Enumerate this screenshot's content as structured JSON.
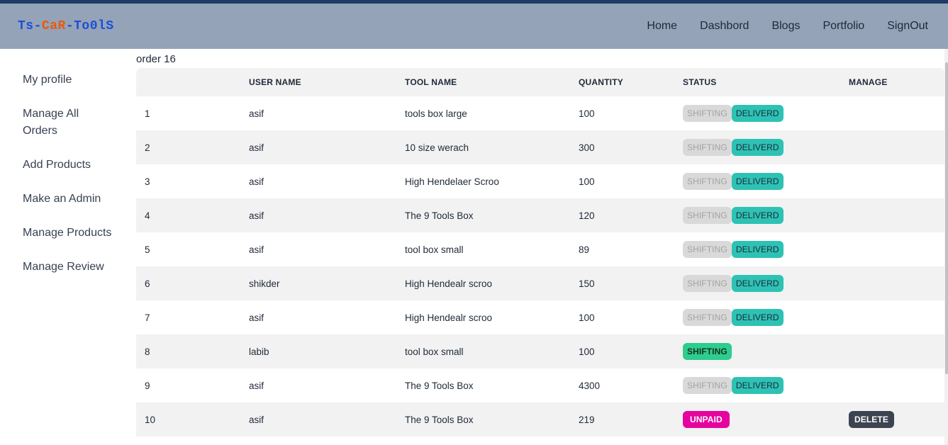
{
  "brand": {
    "part1": "Ts-",
    "part2": "CaR",
    "part3": "-To0lS"
  },
  "nav": {
    "links": [
      "Home",
      "Dashbord",
      "Blogs",
      "Portfolio",
      "SignOut"
    ]
  },
  "sidebar": {
    "items": [
      "My profile",
      "Manage All Orders",
      "Add Products",
      "Make an Admin",
      "Manage Products",
      "Manage Review"
    ]
  },
  "orders": {
    "count_label": "order 16",
    "headers": [
      "",
      "USER NAME",
      "TOOL NAME",
      "QUANTITY",
      "STATUS",
      "MANAGE"
    ],
    "rows": [
      {
        "idx": "1",
        "user": "asif",
        "tool": "tools box large",
        "qty": "100",
        "status": "shipped-delivered"
      },
      {
        "idx": "2",
        "user": "asif",
        "tool": "10 size werach",
        "qty": "300",
        "status": "shipped-delivered"
      },
      {
        "idx": "3",
        "user": "asif",
        "tool": "High Hendelaer Scroo",
        "qty": "100",
        "status": "shipped-delivered"
      },
      {
        "idx": "4",
        "user": "asif",
        "tool": "The 9 Tools Box",
        "qty": "120",
        "status": "shipped-delivered"
      },
      {
        "idx": "5",
        "user": "asif",
        "tool": "tool box small",
        "qty": "89",
        "status": "shipped-delivered"
      },
      {
        "idx": "6",
        "user": "shikder",
        "tool": "High Hendealr scroo",
        "qty": "150",
        "status": "shipped-delivered"
      },
      {
        "idx": "7",
        "user": "asif",
        "tool": "High Hendealr scroo",
        "qty": "100",
        "status": "shipped-delivered"
      },
      {
        "idx": "8",
        "user": "labib",
        "tool": "tool box small",
        "qty": "100",
        "status": "shifting"
      },
      {
        "idx": "9",
        "user": "asif",
        "tool": "The 9 Tools Box",
        "qty": "4300",
        "status": "shipped-delivered"
      },
      {
        "idx": "10",
        "user": "asif",
        "tool": "The 9 Tools Box",
        "qty": "219",
        "status": "unpaid"
      }
    ],
    "labels": {
      "shifting": "SHIFTING",
      "delivered": "DELIVERD",
      "unpaid": "UNPAID",
      "delete": "DELETE"
    }
  },
  "colors": {
    "navbar": "#94a3b8",
    "brand_blue": "#1d4ed8",
    "brand_orange": "#ea580c",
    "delivered": "#2dc2b4",
    "shifting_active": "#2ecc8f",
    "unpaid": "#e6049e",
    "delete": "#3d4451"
  }
}
